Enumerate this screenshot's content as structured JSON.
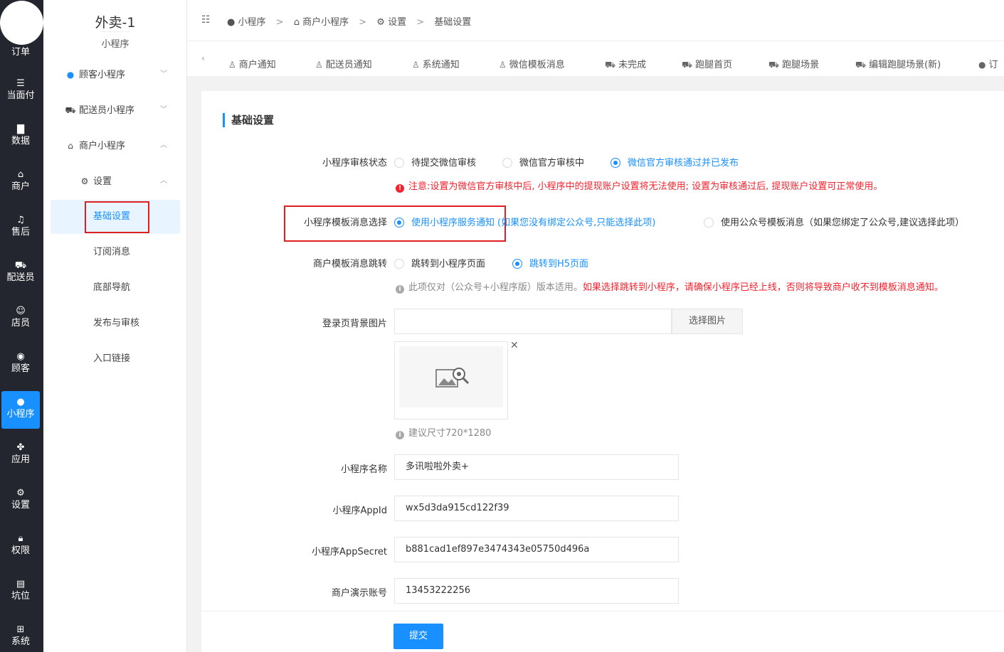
{
  "rail": {
    "items": [
      {
        "label": "订单",
        "icon": "order-icon"
      },
      {
        "label": "当面付",
        "icon": "list-icon"
      },
      {
        "label": "数据",
        "icon": "chart-icon"
      },
      {
        "label": "商户",
        "icon": "store-icon"
      },
      {
        "label": "售后",
        "icon": "headset-icon"
      },
      {
        "label": "配送员",
        "icon": "rider-icon"
      },
      {
        "label": "店员",
        "icon": "staff-icon"
      },
      {
        "label": "顾客",
        "icon": "customer-icon"
      },
      {
        "label": "小程序",
        "icon": "wechat-icon"
      },
      {
        "label": "应用",
        "icon": "apps-icon"
      },
      {
        "label": "设置",
        "icon": "settings-icon"
      },
      {
        "label": "权限",
        "icon": "lock-icon"
      },
      {
        "label": "坑位",
        "icon": "slot-icon"
      },
      {
        "label": "系统",
        "icon": "windows-icon"
      }
    ]
  },
  "sidebar": {
    "title": "外卖-1",
    "subtitle": "小程序",
    "groups": [
      {
        "label": "顾客小程序",
        "icon": "user-circle-icon"
      },
      {
        "label": "配送员小程序",
        "icon": "truck-icon"
      },
      {
        "label": "商户小程序",
        "icon": "store-icon"
      }
    ],
    "settings": {
      "label": "设置",
      "icon": "gear-icon"
    },
    "children": [
      "基础设置",
      "订阅消息",
      "底部导航",
      "发布与审核",
      "入口链接"
    ]
  },
  "breadcrumb": [
    "小程序",
    "商户小程序",
    "设置",
    "基础设置"
  ],
  "tabs": [
    "商户通知",
    "配送员通知",
    "系统通知",
    "微信模板消息",
    "未完成",
    "跑腿首页",
    "跑腿场景",
    "编辑跑腿场景(新)",
    "订"
  ],
  "form": {
    "section_title": "基础设置",
    "audit": {
      "label": "小程序审核状态",
      "options": [
        "待提交微信审核",
        "微信官方审核中",
        "微信官方审核通过并已发布"
      ],
      "selected": 2,
      "note": "注意:设置为微信官方审核中后, 小程序中的提现账户设置将无法使用; 设置为审核通过后, 提现账户设置可正常使用。"
    },
    "template": {
      "label": "小程序模板消息选择",
      "option1": "使用小程序服务通知",
      "option1_hint": "(如果您没有绑定公众号,只能选择此项)",
      "option2": "使用公众号模板消息（如果您绑定了公众号,建议选择此项）",
      "selected": 0
    },
    "jump": {
      "label": "商户模板消息跳转",
      "options": [
        "跳转到小程序页面",
        "跳转到H5页面"
      ],
      "selected": 1,
      "note_gray": "此项仅对（公众号+小程序版）版本适用。",
      "note_red": "如果选择跳转到小程序，请确保小程序已经上线，否则将导致商户收不到模板消息通知。"
    },
    "bg": {
      "label": "登录页背景图片",
      "value": "",
      "button": "选择图片",
      "hint": "建议尺寸720*1280"
    },
    "name": {
      "label": "小程序名称",
      "value": "多讯啦啦外卖+"
    },
    "appid": {
      "label": "小程序AppId",
      "value": "wx5d3da915cd122f39"
    },
    "secret": {
      "label": "小程序AppSecret",
      "value": "b881cad1ef897e3474343e05750d496a"
    },
    "demo": {
      "label": "商户演示账号",
      "value": "13453222256"
    },
    "submit": "提交"
  }
}
